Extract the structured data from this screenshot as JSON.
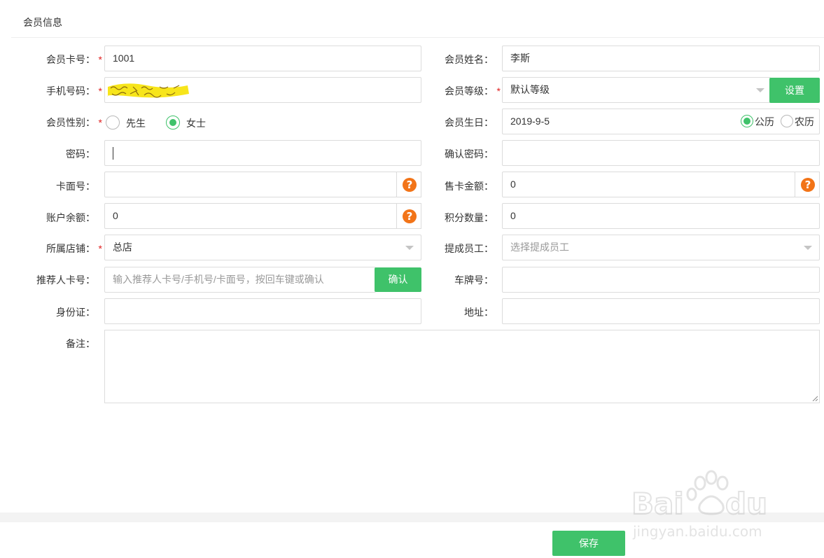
{
  "header": {
    "title": "会员信息"
  },
  "form": {
    "card_no": {
      "label": "会员卡号：",
      "value": "1001"
    },
    "name": {
      "label": "会员姓名：",
      "value": "李斯"
    },
    "phone": {
      "label": "手机号码："
    },
    "level": {
      "label": "会员等级：",
      "value": "默认等级",
      "button": "设置"
    },
    "gender": {
      "label": "会员性别：",
      "options": [
        "先生",
        "女士"
      ],
      "selected": "女士"
    },
    "birthday": {
      "label": "会员生日：",
      "value": "2019-9-5",
      "calendar_options": [
        "公历",
        "农历"
      ],
      "calendar_selected": "公历"
    },
    "password": {
      "label": "密码：",
      "value": ""
    },
    "confirm_password": {
      "label": "确认密码：",
      "value": ""
    },
    "card_face_no": {
      "label": "卡面号：",
      "value": ""
    },
    "sale_amount": {
      "label": "售卡金额：",
      "value": "0"
    },
    "balance": {
      "label": "账户余额：",
      "value": "0"
    },
    "points": {
      "label": "积分数量：",
      "value": "0"
    },
    "store": {
      "label": "所属店铺：",
      "value": "总店"
    },
    "staff": {
      "label": "提成员工：",
      "placeholder": "选择提成员工"
    },
    "referrer": {
      "label": "推荐人卡号：",
      "placeholder": "输入推荐人卡号/手机号/卡面号，按回车键或确认",
      "button": "确认"
    },
    "plate": {
      "label": "车牌号：",
      "value": ""
    },
    "id_card": {
      "label": "身份证：",
      "value": ""
    },
    "address": {
      "label": "地址：",
      "value": ""
    },
    "note": {
      "label": "备注：",
      "value": ""
    }
  },
  "footer": {
    "save_label": "保存"
  },
  "colors": {
    "accent": "#3fc26a",
    "required": "#e02020",
    "help": "#f27418"
  },
  "icons": [
    "help-icon",
    "chevron-down-icon",
    "redacted-scribble"
  ]
}
